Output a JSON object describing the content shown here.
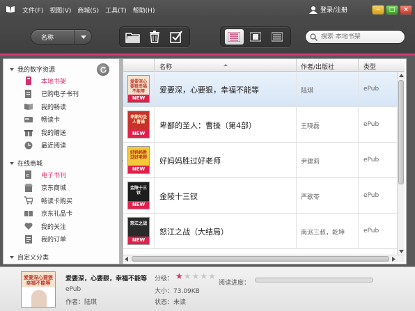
{
  "menu": [
    "文件(F)",
    "视图(V)",
    "商城(S)",
    "工具(T)",
    "帮助(H)"
  ],
  "account": {
    "login_label": "登录/注册"
  },
  "toolbar": {
    "sort_label": "名称"
  },
  "search": {
    "placeholder": "搜索 本地书架"
  },
  "sidebar": {
    "section1": "我的数字资源",
    "items1": [
      {
        "label": "本地书架",
        "icon": "bookshelf-icon"
      },
      {
        "label": "已购电子书刊",
        "icon": "purchased-icon"
      },
      {
        "label": "我的畅读",
        "icon": "open-book-icon"
      },
      {
        "label": "畅读卡",
        "icon": "card-icon"
      },
      {
        "label": "我的赠送",
        "icon": "gift-icon"
      },
      {
        "label": "最近阅读",
        "icon": "clock-icon"
      }
    ],
    "section2": "在线商城",
    "items2": [
      {
        "label": "电子书刊",
        "icon": "ebook-icon"
      },
      {
        "label": "京东商城",
        "icon": "store-icon"
      },
      {
        "label": "畅读卡购买",
        "icon": "cart-icon"
      },
      {
        "label": "京东礼品卡",
        "icon": "gift-card-icon"
      },
      {
        "label": "我的关注",
        "icon": "heart-icon"
      },
      {
        "label": "我的订单",
        "icon": "orders-icon"
      }
    ],
    "section3": "自定义分类"
  },
  "columns": {
    "name": "名称",
    "author": "作者/出版社",
    "type": "类型"
  },
  "books": [
    {
      "title": "爱要深，心要狠，幸福不能等",
      "author": "陆琪",
      "type": "ePub",
      "cover_text": "爱要深心要狠幸福不能等",
      "badge": "NEW",
      "cover_color": "#e9c8a8"
    },
    {
      "title": "卑鄙的圣人：曹操（第4部）",
      "author": "王晓磊",
      "type": "ePub",
      "cover_text": "卑鄙的圣人曹操",
      "badge": "NEW",
      "cover_color": "#c7322c"
    },
    {
      "title": "好妈妈胜过好老师",
      "author": "尹建莉",
      "type": "ePub",
      "cover_text": "好妈妈胜过好老师",
      "badge": "NEW",
      "cover_color": "#f3c93a"
    },
    {
      "title": "金陵十三钗",
      "author": "严歌苓",
      "type": "ePub",
      "cover_text": "金陵十三钗",
      "badge": "NEW",
      "cover_color": "#1d1d1d"
    },
    {
      "title": "怒江之战（大结局）",
      "author": "南派三叔，乾坤",
      "type": "ePub",
      "cover_text": "怒江之战",
      "badge": "NEW",
      "cover_color": "#2a2a2a"
    }
  ],
  "details": {
    "title": "爱要深，心要狠，幸福不能等",
    "type": "ePub",
    "author": "作者：陆琪",
    "rating_label": "分级：",
    "rating": 1,
    "rating_max": 5,
    "size": "大小：73.09KB",
    "status": "状态：未读",
    "progress_label": "阅读进度：",
    "progress": 0,
    "cover_text": "爱要深心要狠幸福不能等"
  },
  "colors": {
    "accent": "#d1306f",
    "selected_row": "#dce8f6"
  }
}
